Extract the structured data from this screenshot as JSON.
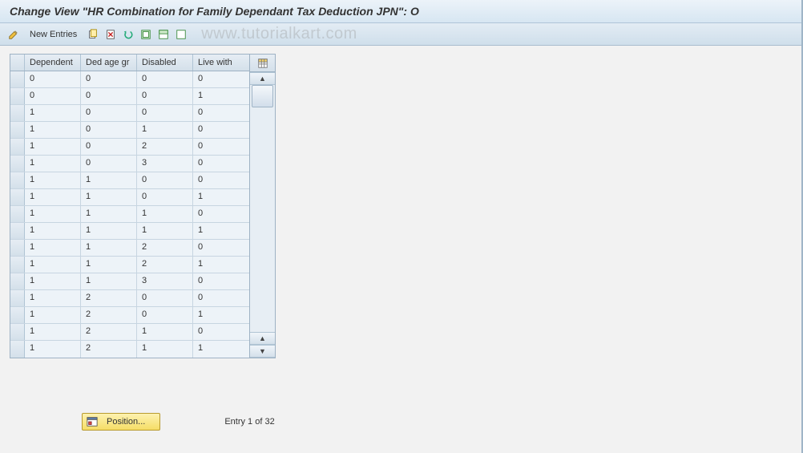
{
  "title": "Change View \"HR Combination for Family Dependant Tax Deduction JPN\": O",
  "toolbar": {
    "new_entries_label": "New Entries"
  },
  "watermark": "www.tutorialkart.com",
  "grid": {
    "columns": [
      "Dependent",
      "Ded age gr",
      "Disabled",
      "Live with"
    ],
    "rows": [
      [
        "0",
        "0",
        "0",
        "0"
      ],
      [
        "0",
        "0",
        "0",
        "1"
      ],
      [
        "1",
        "0",
        "0",
        "0"
      ],
      [
        "1",
        "0",
        "1",
        "0"
      ],
      [
        "1",
        "0",
        "2",
        "0"
      ],
      [
        "1",
        "0",
        "3",
        "0"
      ],
      [
        "1",
        "1",
        "0",
        "0"
      ],
      [
        "1",
        "1",
        "0",
        "1"
      ],
      [
        "1",
        "1",
        "1",
        "0"
      ],
      [
        "1",
        "1",
        "1",
        "1"
      ],
      [
        "1",
        "1",
        "2",
        "0"
      ],
      [
        "1",
        "1",
        "2",
        "1"
      ],
      [
        "1",
        "1",
        "3",
        "0"
      ],
      [
        "1",
        "2",
        "0",
        "0"
      ],
      [
        "1",
        "2",
        "0",
        "1"
      ],
      [
        "1",
        "2",
        "1",
        "0"
      ],
      [
        "1",
        "2",
        "1",
        "1"
      ]
    ]
  },
  "footer": {
    "position_label": "Position...",
    "entry_text": "Entry 1 of 32"
  }
}
